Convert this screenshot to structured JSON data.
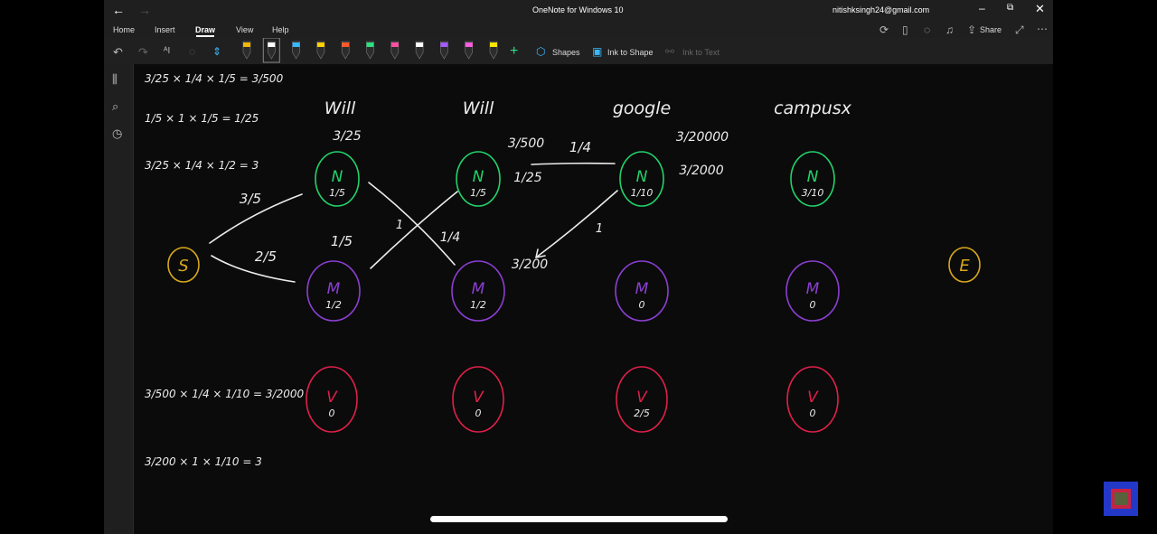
{
  "window": {
    "title": "OneNote for Windows 10",
    "account": "nitishksingh24@gmail.com"
  },
  "menu": {
    "tabs": [
      "Home",
      "Insert",
      "Draw",
      "View",
      "Help"
    ],
    "active": "Draw",
    "share_label": "Share"
  },
  "toolbar": {
    "shapes_label": "Shapes",
    "ink_to_shape_label": "Ink to Shape",
    "ink_to_text_label": "Ink to Text",
    "pen_colors": [
      "#f2b705",
      "#ffffff",
      "#39b8ff",
      "#ffd200",
      "#ff5a2a",
      "#2ee07f",
      "#ff4fa3",
      "#ffffff",
      "#a45cff",
      "#ff5ce1",
      "#ffe500"
    ]
  },
  "ink": {
    "colors": {
      "chalk": "#ececec",
      "n_state": "#22d36a",
      "m_state": "#8b3fd1",
      "v_state": "#e0204a",
      "se_state": "#d7a81c"
    },
    "column_titles": [
      "Will",
      "Will",
      "google",
      "campusx"
    ],
    "start_label": "S",
    "end_label": "E",
    "n_nodes": [
      {
        "letter": "N",
        "value": "1/5"
      },
      {
        "letter": "N",
        "value": "1/5"
      },
      {
        "letter": "N",
        "value": "1/10"
      },
      {
        "letter": "N",
        "value": "3/10"
      }
    ],
    "m_nodes": [
      {
        "letter": "M",
        "value": "1/2"
      },
      {
        "letter": "M",
        "value": "1/2"
      },
      {
        "letter": "M",
        "value": "0"
      },
      {
        "letter": "M",
        "value": "0"
      }
    ],
    "v_nodes": [
      {
        "letter": "V",
        "value": "0"
      },
      {
        "letter": "V",
        "value": "0"
      },
      {
        "letter": "V",
        "value": "2/5"
      },
      {
        "letter": "V",
        "value": "0"
      }
    ],
    "edge_labels": {
      "s_to_n": "3/5",
      "s_to_m": "2/5",
      "n1_score": "3/25",
      "m_above": "1/5",
      "cross_one": "1",
      "cross_quarter": "1/4",
      "n2_score": "3/500",
      "n2_quarter": "1/4",
      "n2_side": "1/25",
      "n3_score": "3/20000",
      "n3_side": "3/2000",
      "m3_one": "1",
      "m3_score": "3/200"
    },
    "formulas": [
      "3/25 × 1/4 × 1/5 = 3/500",
      "1/5 × 1 × 1/5 = 1/25",
      "3/25 × 1/4 × 1/2 = 3",
      "3/500 × 1/4 × 1/10 = 3/2000",
      "3/200 × 1 × 1/10 = 3"
    ]
  }
}
